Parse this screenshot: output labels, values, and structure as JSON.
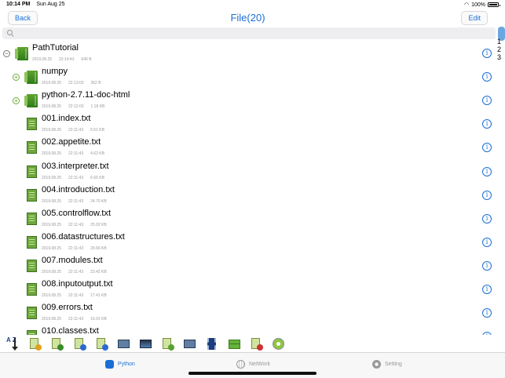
{
  "status_bar": {
    "time": "10:14 PM",
    "date": "Sun Aug 25",
    "battery": "100%"
  },
  "nav": {
    "back_label": "Back",
    "title": "File(20)",
    "edit_label": "Edit"
  },
  "search": {
    "placeholder": "",
    "value": ""
  },
  "file_list": [
    {
      "name": "PathTutorial",
      "date": "2019.08.25",
      "time": "22:14:43",
      "size": "640 B",
      "kind": "folder",
      "toggle": "⊖",
      "level": 0
    },
    {
      "name": "numpy",
      "date": "2019.08.25",
      "time": "22:13:03",
      "size": "352 B",
      "kind": "folder",
      "toggle": "⊕",
      "level": 1
    },
    {
      "name": "python-2.7.11-doc-html",
      "date": "2019.08.25",
      "time": "22:12:03",
      "size": "1.18 KB",
      "kind": "folder",
      "toggle": "⊕",
      "level": 1
    },
    {
      "name": "001.index.txt",
      "date": "2019.08.25",
      "time": "22:11:43",
      "size": "5.51 KB",
      "kind": "file",
      "level": 1
    },
    {
      "name": "002.appetite.txt",
      "date": "2019.08.25",
      "time": "22:11:43",
      "size": "4.62 KB",
      "kind": "file",
      "level": 1
    },
    {
      "name": "003.interpreter.txt",
      "date": "2019.08.25",
      "time": "22:11:43",
      "size": "6.65 KB",
      "kind": "file",
      "level": 1
    },
    {
      "name": "004.introduction.txt",
      "date": "2019.08.25",
      "time": "22:11:43",
      "size": "24.70 KB",
      "kind": "file",
      "level": 1
    },
    {
      "name": "005.controlflow.txt",
      "date": "2019.08.25",
      "time": "22:11:43",
      "size": "25.02 KB",
      "kind": "file",
      "level": 1
    },
    {
      "name": "006.datastructures.txt",
      "date": "2019.08.25",
      "time": "22:11:43",
      "size": "29.66 KB",
      "kind": "file",
      "level": 1
    },
    {
      "name": "007.modules.txt",
      "date": "2019.08.25",
      "time": "22:11:43",
      "size": "23.42 KB",
      "kind": "file",
      "level": 1
    },
    {
      "name": "008.inputoutput.txt",
      "date": "2019.08.25",
      "time": "22:11:43",
      "size": "17.41 KB",
      "kind": "file",
      "level": 1
    },
    {
      "name": "009.errors.txt",
      "date": "2019.08.25",
      "time": "22:11:43",
      "size": "16.01 KB",
      "kind": "file",
      "level": 1
    },
    {
      "name": "010.classes.txt",
      "date": "",
      "time": "",
      "size": "",
      "kind": "file",
      "level": 1
    }
  ],
  "index_bar": [
    "1",
    "2",
    "3"
  ],
  "toolbar": [
    {
      "name": "sort-az-icon",
      "label": "A\nZ"
    },
    {
      "name": "new-file-icon",
      "badge": "#e0a020"
    },
    {
      "name": "import-file-icon",
      "badge": "#3a8a2a"
    },
    {
      "name": "download-icon",
      "badge": "#2a6ad0"
    },
    {
      "name": "file-info-icon",
      "badge": "#2a6ad0"
    },
    {
      "name": "screen-capture-icon"
    },
    {
      "name": "terminal-icon"
    },
    {
      "name": "tree-icon",
      "badge": "#5aa030"
    },
    {
      "name": "camera-icon"
    },
    {
      "name": "film-icon"
    },
    {
      "name": "archive-icon"
    },
    {
      "name": "delete-icon",
      "badge": "#d03030"
    },
    {
      "name": "disc-icon"
    }
  ],
  "tabs": [
    {
      "label": "Python",
      "icon": "python-icon",
      "active": true
    },
    {
      "label": "NetWork",
      "icon": "globe-icon",
      "active": false
    },
    {
      "label": "Setting",
      "icon": "gear-icon",
      "active": false
    }
  ],
  "colors": {
    "accent": "#1a6fd6",
    "folder_green": "#4a9428",
    "meta_gray": "#999999"
  },
  "info_glyph": "i"
}
